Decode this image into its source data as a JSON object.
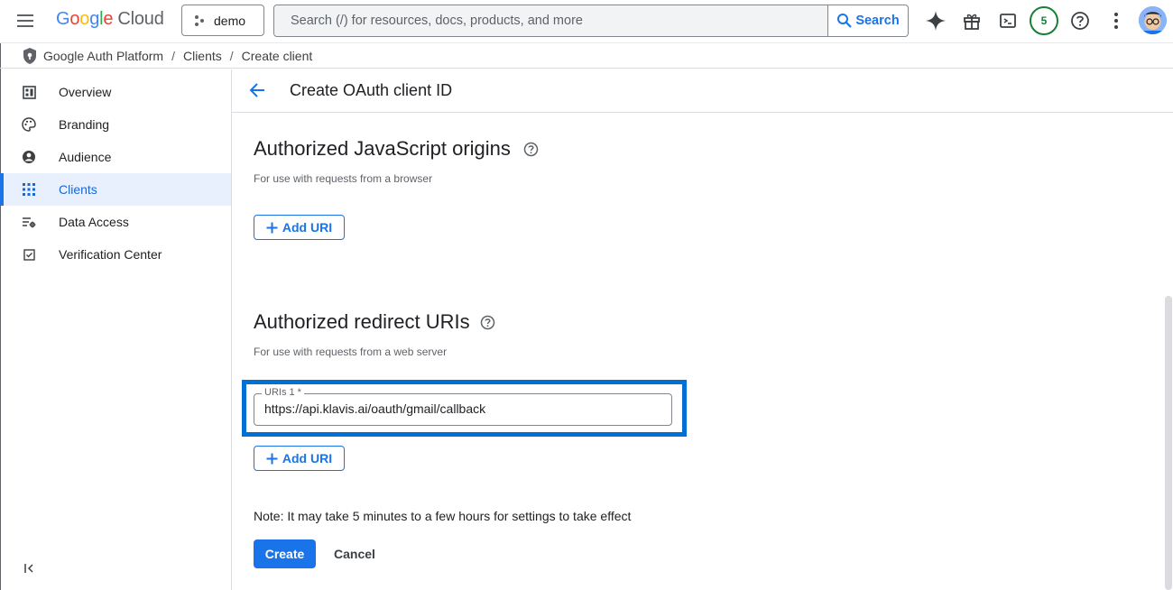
{
  "topbar": {
    "logo_letters": [
      "G",
      "o",
      "o",
      "g",
      "l",
      "e"
    ],
    "logo_product": "Cloud",
    "project_name": "demo",
    "search_placeholder": "Search (/) for resources, docs, products, and more",
    "search_button": "Search",
    "notification_count": "5",
    "icons": [
      "menu-icon",
      "project-icon",
      "search-icon",
      "gemini-sparkle-icon",
      "gift-icon",
      "cloud-shell-icon",
      "help-icon",
      "more-vert-icon",
      "avatar"
    ]
  },
  "breadcrumb": {
    "items": [
      "Google Auth Platform",
      "Clients",
      "Create client"
    ],
    "separator": "/"
  },
  "sidebar": {
    "items": [
      {
        "label": "Overview",
        "icon": "dashboard-icon"
      },
      {
        "label": "Branding",
        "icon": "palette-icon"
      },
      {
        "label": "Audience",
        "icon": "person-icon"
      },
      {
        "label": "Clients",
        "icon": "apps-grid-icon",
        "active": true
      },
      {
        "label": "Data Access",
        "icon": "data-access-icon"
      },
      {
        "label": "Verification Center",
        "icon": "verification-icon"
      }
    ],
    "collapse_icon": "collapse-icon"
  },
  "page": {
    "title": "Create OAuth client ID"
  },
  "js_origins": {
    "title": "Authorized JavaScript origins",
    "hint": "For use with requests from a browser",
    "add_label": "Add URI"
  },
  "redirect_uris": {
    "title": "Authorized redirect URIs",
    "hint": "For use with requests from a web server",
    "field_label": "URIs 1 *",
    "field_value": "https://api.klavis.ai/oauth/gmail/callback",
    "add_label": "Add URI"
  },
  "footer": {
    "note": "Note: It may take 5 minutes to a few hours for settings to take effect",
    "create_label": "Create",
    "cancel_label": "Cancel"
  },
  "colors": {
    "accent": "#1a73e8",
    "focus_outline": "#0070d6",
    "active_bg": "#e8f0fe",
    "badge": "#188038"
  }
}
